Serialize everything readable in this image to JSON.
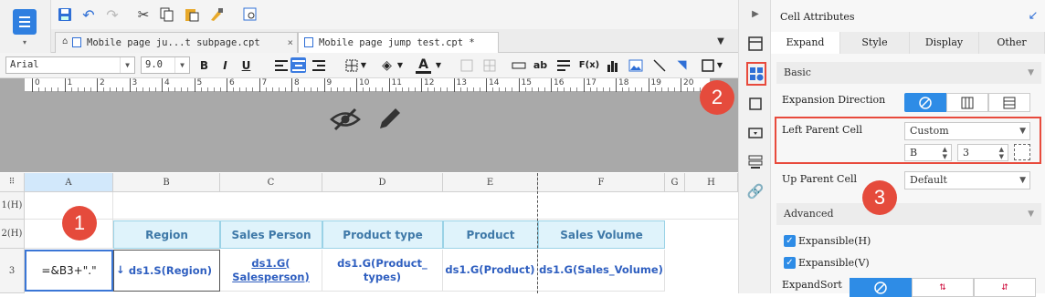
{
  "tabs": [
    {
      "label": "Mobile page ju...t subpage.cpt",
      "close": "×"
    },
    {
      "label": "Mobile page jump test.cpt *"
    }
  ],
  "format": {
    "font": "Arial",
    "size": "9.0",
    "bold": "B",
    "italic": "I",
    "underline": "U",
    "font_color_label": "A",
    "text_icon": "ab",
    "formula_icon": "F(x)"
  },
  "ruler": [
    "0",
    "1",
    "2",
    "3",
    "4",
    "5",
    "6",
    "7",
    "8",
    "9",
    "10",
    "11",
    "12",
    "13",
    "14",
    "15",
    "16",
    "17",
    "18",
    "19",
    "20"
  ],
  "grid": {
    "columns": [
      "A",
      "B",
      "C",
      "D",
      "E",
      "F",
      "G",
      "H"
    ],
    "rows": [
      "1(H)",
      "2(H)",
      "3"
    ],
    "headers": [
      "Region",
      "Sales Person",
      "Product type",
      "Product",
      "Sales Volume"
    ],
    "a3": "=&B3+\".\"",
    "data": [
      "ds1.S(Region)",
      "ds1.G(\nSalesperson)",
      "ds1.G(Product_\ntypes)",
      "ds1.G(Product)",
      "ds1.G(Sales_Volume)"
    ],
    "arrow": "↓"
  },
  "panel": {
    "title": "Cell Attributes",
    "tabs": [
      "Expand",
      "Style",
      "Display",
      "Other"
    ],
    "basic": "Basic",
    "expansion_direction": "Expansion Direction",
    "left_parent": "Left Parent Cell",
    "left_parent_value": "Custom",
    "left_col": "B",
    "left_row": "3",
    "up_parent": "Up Parent Cell",
    "up_parent_value": "Default",
    "advanced": "Advanced",
    "expansible_h": "Expansible(H)",
    "expansible_v": "Expansible(V)",
    "expand_sort": "ExpandSort",
    "check": "✓"
  },
  "badges": [
    "1",
    "2",
    "3"
  ],
  "colors": {
    "accent": "#2e8ce6",
    "header_bg": "#dff3fb",
    "badge": "#e54b3c"
  }
}
